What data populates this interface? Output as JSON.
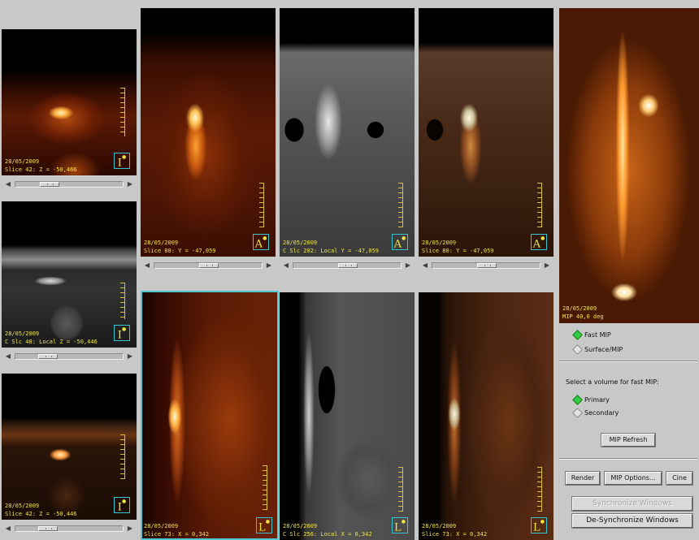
{
  "colors": {
    "accent_cyan": "#4fc8d2",
    "overlay_text": "#f0e442",
    "radio_on": "#2ecc40"
  },
  "viewports": {
    "axial_pet": {
      "date": "28/05/2009",
      "info": "Slice 42: Z = -50,466",
      "orient": "I"
    },
    "axial_ct": {
      "date": "28/05/2009",
      "info": "C Slc 48: Local Z = -50,446",
      "orient": "I"
    },
    "axial_fusion": {
      "date": "28/05/2009",
      "info": "Slice 42: Z = -50,446",
      "orient": "I"
    },
    "coronal_pet": {
      "date": "28/05/2009",
      "info": "Slice 80: Y = -47,059",
      "orient": "A"
    },
    "coronal_ct": {
      "date": "28/05/2009",
      "info": "C Slc 202: Local Y = -47,059",
      "orient": "A"
    },
    "coronal_fusion": {
      "date": "28/05/2009",
      "info": "Slice 80: Y = -47,059",
      "orient": "A"
    },
    "sagittal_pet": {
      "date": "28/05/2009",
      "info": "Slice 73: X = 0,342",
      "orient": "L"
    },
    "sagittal_ct": {
      "date": "28/05/2009",
      "info": "C Slc 256: Local X = 0,342",
      "orient": "L"
    },
    "sagittal_fusion": {
      "date": "28/05/2009",
      "info": "Slice 73: X = 0,342",
      "orient": "L"
    },
    "mip": {
      "date": "28/05/2009",
      "info": "MIP 40,0 deg"
    }
  },
  "scrollbars": {
    "axial_pet": 0.4,
    "axial_ct": 0.38,
    "axial_fusion": 0.38,
    "coronal_pet": 0.5,
    "coronal_ct": 0.5,
    "coronal_fusion": 0.5
  },
  "mip_panel": {
    "mode_options": [
      {
        "label": "Fast MIP",
        "selected": true
      },
      {
        "label": "Surface/MIP",
        "selected": false
      }
    ],
    "volume_prompt": "Select a volume for fast MIP:",
    "volume_options": [
      {
        "label": "Primary",
        "selected": true
      },
      {
        "label": "Secondary",
        "selected": false
      }
    ],
    "mip_refresh_label": "MIP Refresh",
    "render_label": "Render",
    "mip_options_label": "MIP Options...",
    "cine_label": "Cine",
    "sync_label": "Synchronize Windows",
    "desync_label": "De-Synchronize Windows"
  }
}
